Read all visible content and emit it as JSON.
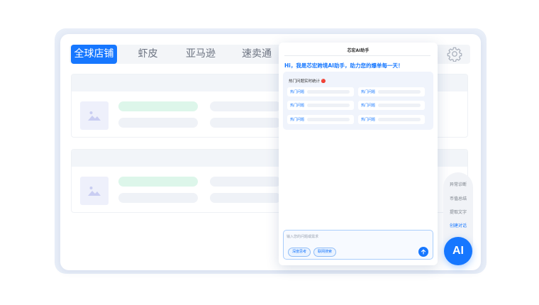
{
  "tabs": [
    {
      "label": "全球店铺",
      "active": true
    },
    {
      "label": "虾皮",
      "active": false
    },
    {
      "label": "亚马逊",
      "active": false
    },
    {
      "label": "速卖通",
      "active": false
    }
  ],
  "chat": {
    "title": "芯宏AI助手",
    "greeting": "Hi，我是芯宏跨境AI助手，助力您的爆单每一天！",
    "hot_title": "热门问题实时统计 🔴",
    "hot_items": [
      "热门问题",
      "热门问题",
      "热门问题",
      "热门问题",
      "热门问题",
      "热门问题"
    ],
    "input_placeholder": "输入您的问题或需求",
    "chips": [
      "深度思考",
      "联网搜索"
    ]
  },
  "side_menu": {
    "items": [
      "异常诊断",
      "币值总结",
      "提取文字",
      "创建对话"
    ],
    "active_item": "创建对话"
  },
  "ai_button": "AI",
  "colors": {
    "accent": "#1677ff",
    "success_light": "#ddf6ea"
  },
  "icons": {
    "settings": "gear-icon",
    "thumbnail": "image-placeholder-icon",
    "send": "arrow-up-icon"
  }
}
